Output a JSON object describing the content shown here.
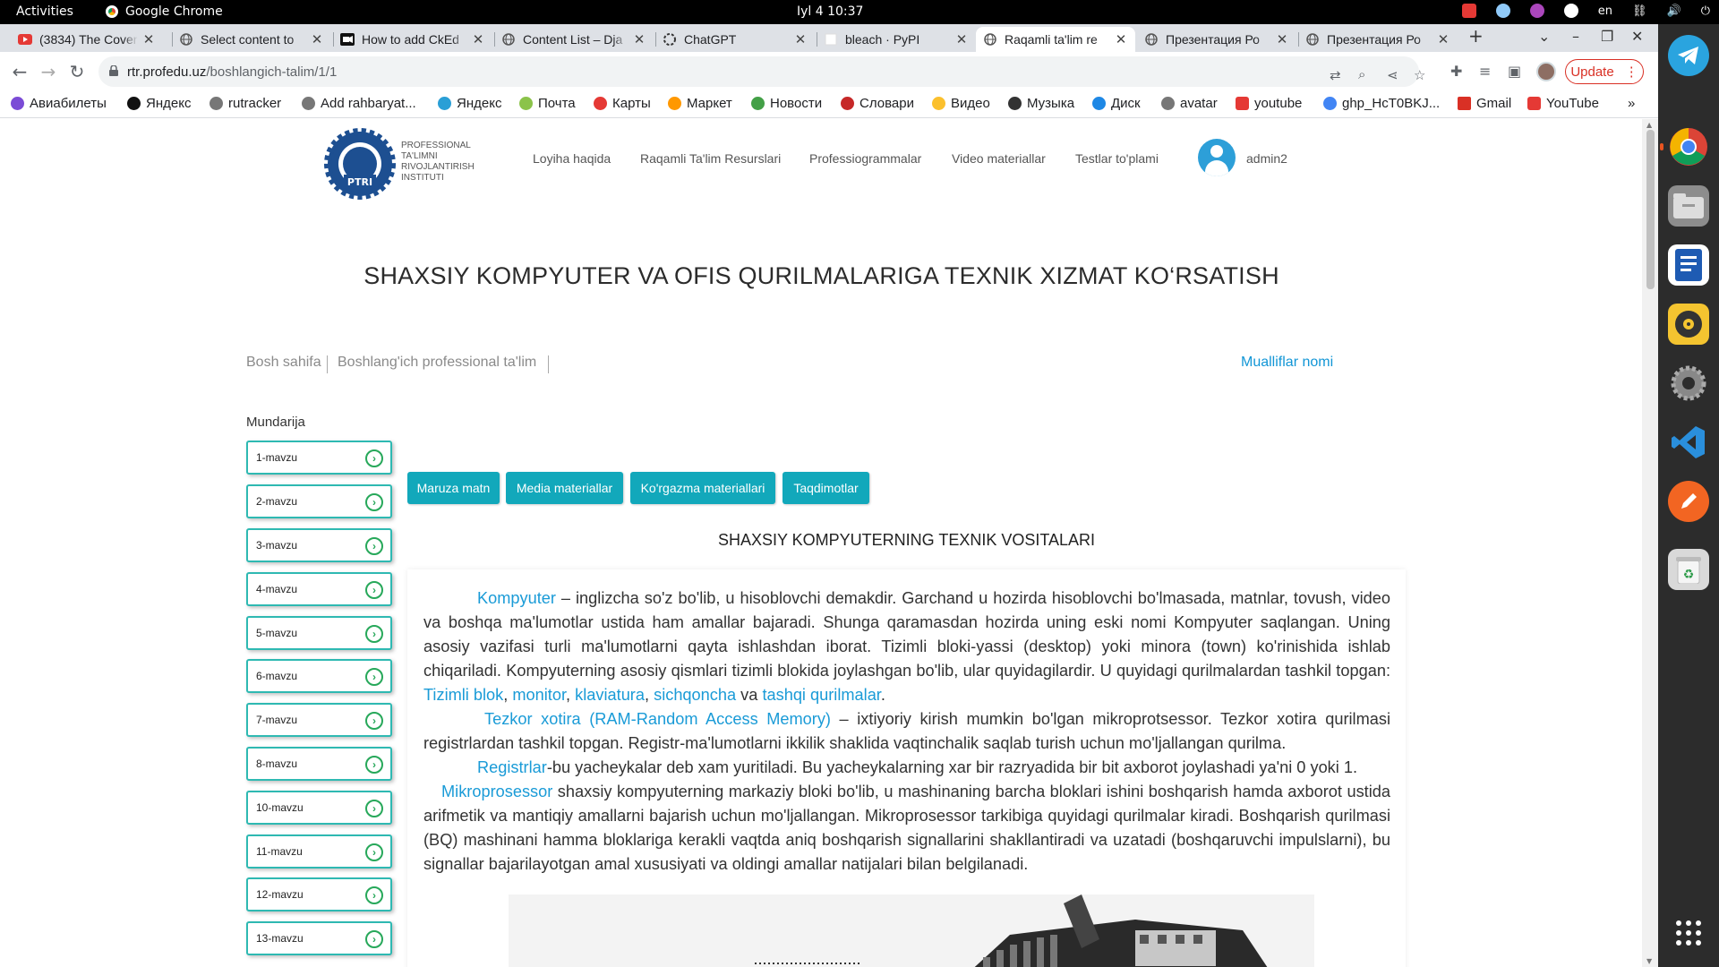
{
  "system": {
    "activities": "Activities",
    "app_name": "Google Chrome",
    "clock": "Iyl 4  10:37",
    "lang": "en"
  },
  "browser": {
    "tabs": [
      {
        "title": "(3834) The Cover",
        "icon": "youtube-icon",
        "active": false
      },
      {
        "title": "Select content to",
        "icon": "globe-icon",
        "active": false
      },
      {
        "title": "How to add CkEd",
        "icon": "video-icon",
        "active": false
      },
      {
        "title": "Content List – Dja",
        "icon": "globe-icon",
        "active": false
      },
      {
        "title": "ChatGPT",
        "icon": "chatgpt-icon",
        "active": false
      },
      {
        "title": "bleach · PyPI",
        "icon": "pypi-icon",
        "active": false
      },
      {
        "title": "Raqamli ta'lim re",
        "icon": "globe-icon",
        "active": true
      },
      {
        "title": "Презентация Ро",
        "icon": "globe-icon",
        "active": false
      },
      {
        "title": "Презентация Ро",
        "icon": "globe-icon",
        "active": false
      }
    ],
    "url_host": "rtr.profedu.uz",
    "url_path": "/boshlangich-talim/1/1",
    "update_label": "Update",
    "bookmarks": [
      {
        "label": "Авиабилеты",
        "color": "#7b4bd6"
      },
      {
        "label": "Яндекс",
        "color": "#111111"
      },
      {
        "label": "rutracker",
        "color": "#555555"
      },
      {
        "label": "Add rahbaryat...",
        "color": "#555555"
      },
      {
        "label": "Яндекс",
        "color": "#2a9fd6"
      },
      {
        "label": "Почта",
        "color": "#8bc34a"
      },
      {
        "label": "Карты",
        "color": "#e53935"
      },
      {
        "label": "Маркет",
        "color": "#ff9800"
      },
      {
        "label": "Новости",
        "color": "#43a047"
      },
      {
        "label": "Словари",
        "color": "#c62828"
      },
      {
        "label": "Видео",
        "color": "#fbc02d"
      },
      {
        "label": "Музыка",
        "color": "#333333"
      },
      {
        "label": "Диск",
        "color": "#1e88e5"
      },
      {
        "label": "avatar",
        "color": "#555555"
      },
      {
        "label": "youtube",
        "color": "#e53935"
      },
      {
        "label": "ghp_HcT0BKJ...",
        "color": "#4285f4"
      },
      {
        "label": "Gmail",
        "color": "#d93025"
      },
      {
        "label": "YouTube",
        "color": "#e53935"
      }
    ]
  },
  "site": {
    "logo_text": "Professional ta'limni rivojlantirish instituti",
    "logo_abbr": "PTRI",
    "nav": [
      "Loyiha haqida",
      "Raqamli Ta'lim Resurslari",
      "Professiogrammalar",
      "Video materiallar",
      "Testlar to'plami"
    ],
    "username": "admin2",
    "page_title": "SHAXSIY KOMPYUTER VA OFIS QURILMALARIGA TEXNIK XIZMAT KO‘RSATISH",
    "breadcrumb": [
      "Bosh sahifa",
      "Boshlang'ich professional ta'lim"
    ],
    "authors": "Mualliflar nomi",
    "toc_title": "Mundarija",
    "topics": [
      "1-mavzu",
      "2-mavzu",
      "3-mavzu",
      "4-mavzu",
      "5-mavzu",
      "6-mavzu",
      "7-mavzu",
      "8-mavzu",
      "10-mavzu",
      "11-mavzu",
      "12-mavzu",
      "13-mavzu"
    ],
    "content_tabs": [
      "Maruza matn",
      "Media materiallar",
      "Ko'rgazma materiallari",
      "Taqdimotlar"
    ],
    "section_title": "SHAXSIY KOMPYUTERNING TEXNIK VOSITALARI",
    "para1": {
      "term": "Kompyuter",
      "text": " – inglizcha so'z bo'lib, u hisoblovchi demakdir. Garchand u hozirda hisoblovchi bo'lmasada, matnlar, tovush, video va boshqa ma'lumotlar ustida ham amallar bajaradi. Shunga qaramasdan hozirda uning eski nomi Kompyuter saqlangan. Uning asosiy vazifasi turli ma'lumotlarni qayta ishlashdan iborat. Tizimli bloki-yassi (desktop) yoki minora (town) ko'rinishida ishlab chiqariladi. Kompyuterning asosiy qismlari tizimli blokida joylashgan bo'lib, ular quyidagilardir. U quyidagi qurilmalardan tashkil topgan: ",
      "links": [
        "Tizimli blok",
        "monitor",
        "klaviatura",
        "sichqoncha",
        "tashqi qurilmalar"
      ],
      "sep": ", ",
      "and": " va ",
      "end": "."
    },
    "para2": {
      "term": "Tezkor xotira (RAM-Random Access Memory)",
      "text": " – ixtiyoriy kirish mumkin bo'lgan mikroprotsessor. Tezkor xotira qurilmasi registrlardan tashkil topgan. Registr-ma'lumotlarni ikkilik shaklida vaqtinchalik saqlab turish uchun mo'ljallangan qurilma."
    },
    "para3": {
      "term": "Registrlar",
      "text": "-bu yacheykalar deb xam yuritiladi. Bu yacheykalarning xar bir razryadida bir bit axborot joylashadi ya'ni 0 yoki 1."
    },
    "para4": {
      "term": "Mikroprosessor",
      "text": " shaxsiy kompyuterning markaziy bloki bo'lib, u mashinaning barcha bloklari ishini boshqarish hamda axborot ustida arifmetik va mantiqiy amallarni bajarish uchun mo'ljallangan. Mikroprosessor tarkibiga quyidagi qurilmalar kiradi. Boshqarish qurilmasi (BQ) mashinani hamma bloklariga kerakli vaqtda aniq boshqarish signallarini shakllantiradi va uzatadi (boshqaruvchi impulslarni), bu signallar bajarilayotgan amal xususiyati va oldingi amallar natijalari bilan belgilanadi."
    }
  },
  "colors": {
    "accent": "#12a8bb",
    "link": "#1a9bd7",
    "topic_border": "#2eb9b2",
    "topic_go": "#27a85a"
  }
}
